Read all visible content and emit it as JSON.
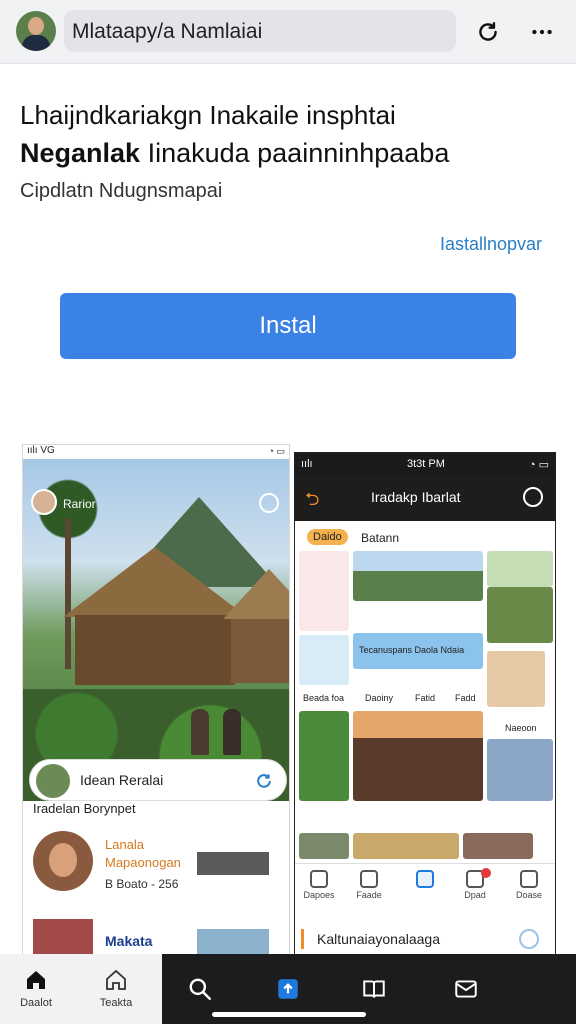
{
  "header": {
    "url_text": "Mlataapy/a Namlaiai"
  },
  "hero": {
    "title_line1": "Lhaijndkariakgn Inakaile insphtai",
    "title_line2_bold": "Neganlak",
    "title_line2_rest": " Iinakuda paainninhpaaba",
    "subtitle": "Cipdlatn Ndugnsmapai",
    "install_link": "Iastallnopvar",
    "install_button": "Instal"
  },
  "screenshot1": {
    "status_left": "ıılı VG",
    "profile_name": "Rarior",
    "pill_label": "Idean Reralai",
    "section_title": "Iradelan Borynpet",
    "row1": {
      "name": "Lanala",
      "sub": "Mapaonogan",
      "meta": "B  Boato - 256"
    },
    "row2": {
      "label": "Makata"
    }
  },
  "screenshot2": {
    "status_left": "ıılı",
    "time": "3t3t PM",
    "header_title": "Iradakp Ibarlat",
    "tag": "Daido",
    "tag_name": "Batann",
    "captions": [
      "Tecanuspans Daola Ndaia",
      "Beada foa",
      "Daoiny",
      "Fatid",
      "Fadd",
      "Naeoon"
    ],
    "nav": [
      "Dapoes",
      "Faade",
      "",
      "Dpad",
      "Doase"
    ],
    "footer_title": "Kaltunaiayonalaaga"
  },
  "bottom_nav": {
    "items": [
      {
        "label": "Daalot",
        "icon": "home-icon"
      },
      {
        "label": "Teakta",
        "icon": "home-outline-icon"
      },
      {
        "label": "",
        "icon": "search-icon"
      },
      {
        "label": "",
        "icon": "upload-icon"
      },
      {
        "label": "",
        "icon": "book-icon"
      },
      {
        "label": "",
        "icon": "mail-icon"
      }
    ]
  },
  "colors": {
    "accent": "#3b82e6",
    "link": "#2a7fc8",
    "dark_nav": "#1c1c1e"
  }
}
